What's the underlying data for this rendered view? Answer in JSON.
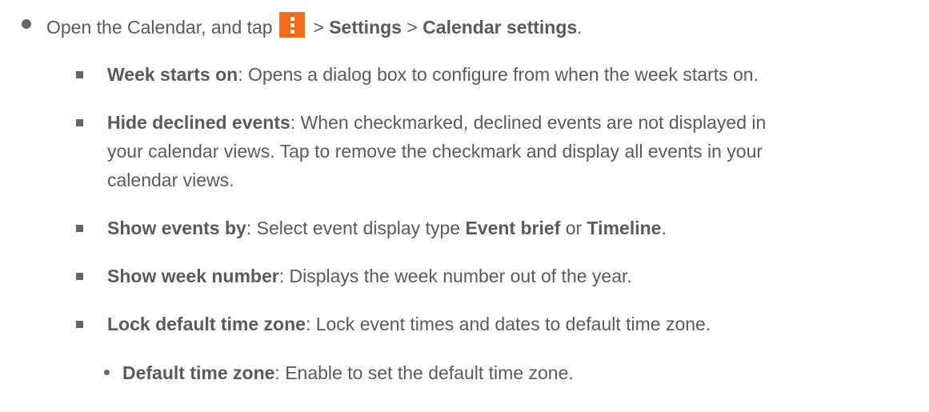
{
  "intro": {
    "prefix": "Open the Calendar, and tap",
    "sep1": ">",
    "settings": "Settings",
    "sep2": ">",
    "calendar_settings": "Calendar settings",
    "end": ".",
    "icon": "menu-icon"
  },
  "items": [
    {
      "term": "Week starts on",
      "desc": ": Opens a dialog box to configure from when the week starts on."
    },
    {
      "term": "Hide declined events",
      "desc_line1": ": When checkmarked, declined events are not displayed in",
      "desc_line2": "your calendar views. Tap to remove the checkmark and display all events in your",
      "desc_line3": "calendar views."
    },
    {
      "term": "Show events by",
      "desc": ": Select event display type ",
      "opt1": "Event brief",
      "or": " or ",
      "opt2": "Timeline",
      "end": "."
    },
    {
      "term": "Show week number",
      "desc": ": Displays the week number out of the year."
    },
    {
      "term": "Lock default time zone",
      "desc": ": Lock event times and dates to default time zone."
    }
  ],
  "subitem": {
    "term": "Default time zone",
    "desc": ": Enable to set the default time zone."
  },
  "colors": {
    "text": "#5a5a5a",
    "accent": "#f36b1c"
  }
}
